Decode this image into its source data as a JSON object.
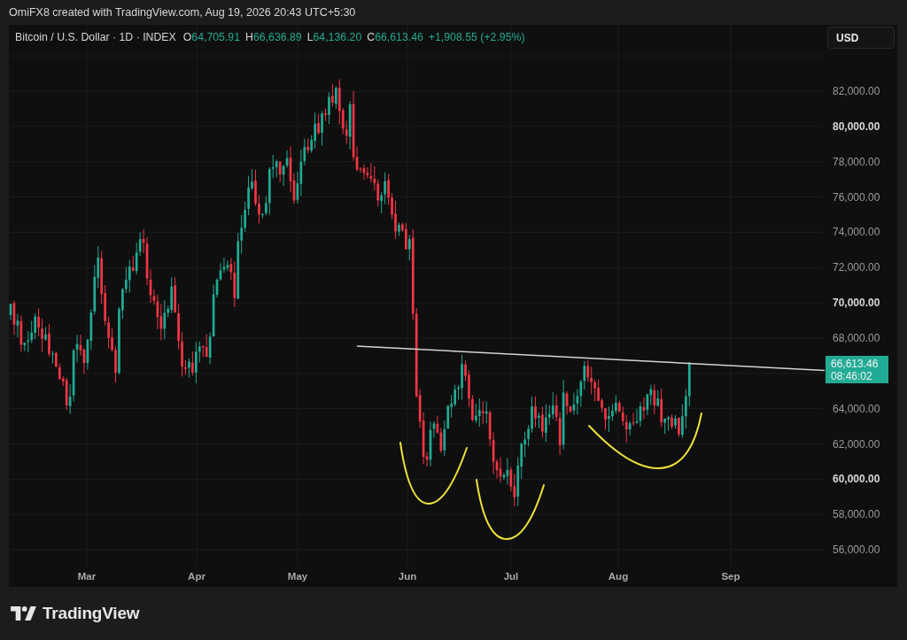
{
  "header": {
    "caption": "OmiFX8 created with TradingView.com, Aug 19, 2026 20:43 UTC+5:30"
  },
  "legend": {
    "symbol": "Bitcoin / U.S. Dollar · 1D · INDEX",
    "rising": true,
    "ohlc": [
      {
        "label": "O",
        "value": "64,705.91"
      },
      {
        "label": "H",
        "value": "66,636.89"
      },
      {
        "label": "L",
        "value": "64,136.20"
      },
      {
        "label": "C",
        "value": "66,613.46"
      }
    ],
    "change": "+1,908.55 (+2.95%)"
  },
  "currency_button": {
    "label": "USD"
  },
  "price_axis": {
    "labels": [
      {
        "text": "82,000.00",
        "bold": false
      },
      {
        "text": "80,000.00",
        "bold": true
      },
      {
        "text": "78,000.00",
        "bold": false
      },
      {
        "text": "76,000.00",
        "bold": false
      },
      {
        "text": "74,000.00",
        "bold": false
      },
      {
        "text": "72,000.00",
        "bold": false
      },
      {
        "text": "70,000.00",
        "bold": true
      },
      {
        "text": "68,000.00",
        "bold": false
      },
      {
        "text": "64,000.00",
        "bold": false
      },
      {
        "text": "62,000.00",
        "bold": false
      },
      {
        "text": "60,000.00",
        "bold": true
      },
      {
        "text": "58,000.00",
        "bold": false
      },
      {
        "text": "56,000.00",
        "bold": false
      }
    ]
  },
  "price_tag": {
    "price": "66,613.46",
    "countdown": "08:46:02",
    "rising": true
  },
  "time_axis": {
    "labels": [
      "Mar",
      "Apr",
      "May",
      "Jun",
      "Jul",
      "Aug",
      "Sep"
    ]
  },
  "footer": {
    "brand": "TradingView"
  }
}
